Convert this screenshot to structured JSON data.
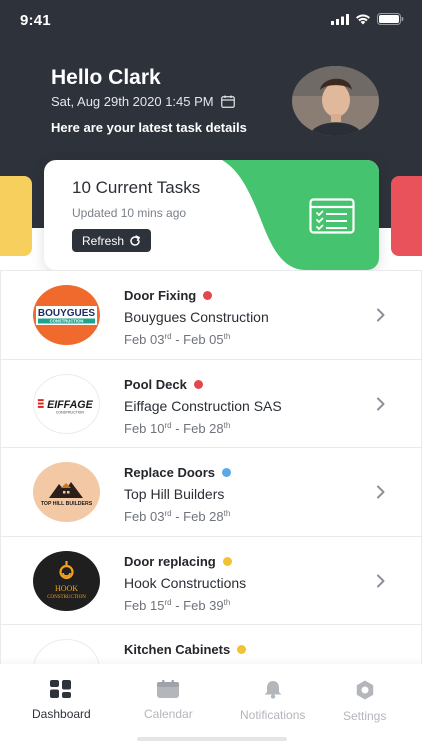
{
  "status_bar": {
    "time": "9:41"
  },
  "header": {
    "greeting": "Hello Clark",
    "datetime": "Sat, Aug 29th 2020 1:45 PM",
    "subtitle": "Here are your latest task details"
  },
  "summary_card": {
    "title": "10 Current Tasks",
    "updated": "Updated 10 mins ago",
    "refresh_label": "Refresh"
  },
  "tasks": [
    {
      "title": "Door Fixing",
      "company": "Bouygues Construction",
      "start_date": "Feb 03",
      "start_suffix": "rd",
      "end_date": "Feb 05",
      "end_suffix": "th",
      "dot_color": "#e2474f",
      "logo_text": "BOUYGUES",
      "logo_subtext": "CONSTRUCTION"
    },
    {
      "title": "Pool Deck",
      "company": "Eiffage Construction SAS",
      "start_date": "Feb 10",
      "start_suffix": "rd",
      "end_date": "Feb 28",
      "end_suffix": "th",
      "dot_color": "#e2474f",
      "logo_text": "EIFFAGE",
      "logo_subtext": "CONSTRUCTION"
    },
    {
      "title": "Replace Doors",
      "company": "Top Hill Builders",
      "start_date": "Feb 03",
      "start_suffix": "rd",
      "end_date": "Feb 28",
      "end_suffix": "th",
      "dot_color": "#5aa9e6",
      "logo_text": "TOP HILL BUILDERS"
    },
    {
      "title": "Door replacing",
      "company": "Hook Constructions",
      "start_date": "Feb 15",
      "start_suffix": "rd",
      "end_date": "Feb 39",
      "end_suffix": "th",
      "dot_color": "#f2c233",
      "logo_text": "HOOK",
      "logo_subtext": "CONSTRUCTION"
    },
    {
      "title": "Kitchen Cabinets",
      "dot_color": "#f2c233"
    }
  ],
  "nav": {
    "items": [
      {
        "label": "Dashboard",
        "icon": "dashboard-icon",
        "active": true
      },
      {
        "label": "Calendar",
        "icon": "calendar-icon",
        "active": false
      },
      {
        "label": "Notifications",
        "icon": "bell-icon",
        "active": false
      },
      {
        "label": "Settings",
        "icon": "settings-icon",
        "active": false
      }
    ]
  },
  "colors": {
    "header_bg": "#2e323a",
    "accent_green": "#46c36f",
    "card_yellow": "#f6cf5c",
    "card_red": "#e9525a"
  }
}
